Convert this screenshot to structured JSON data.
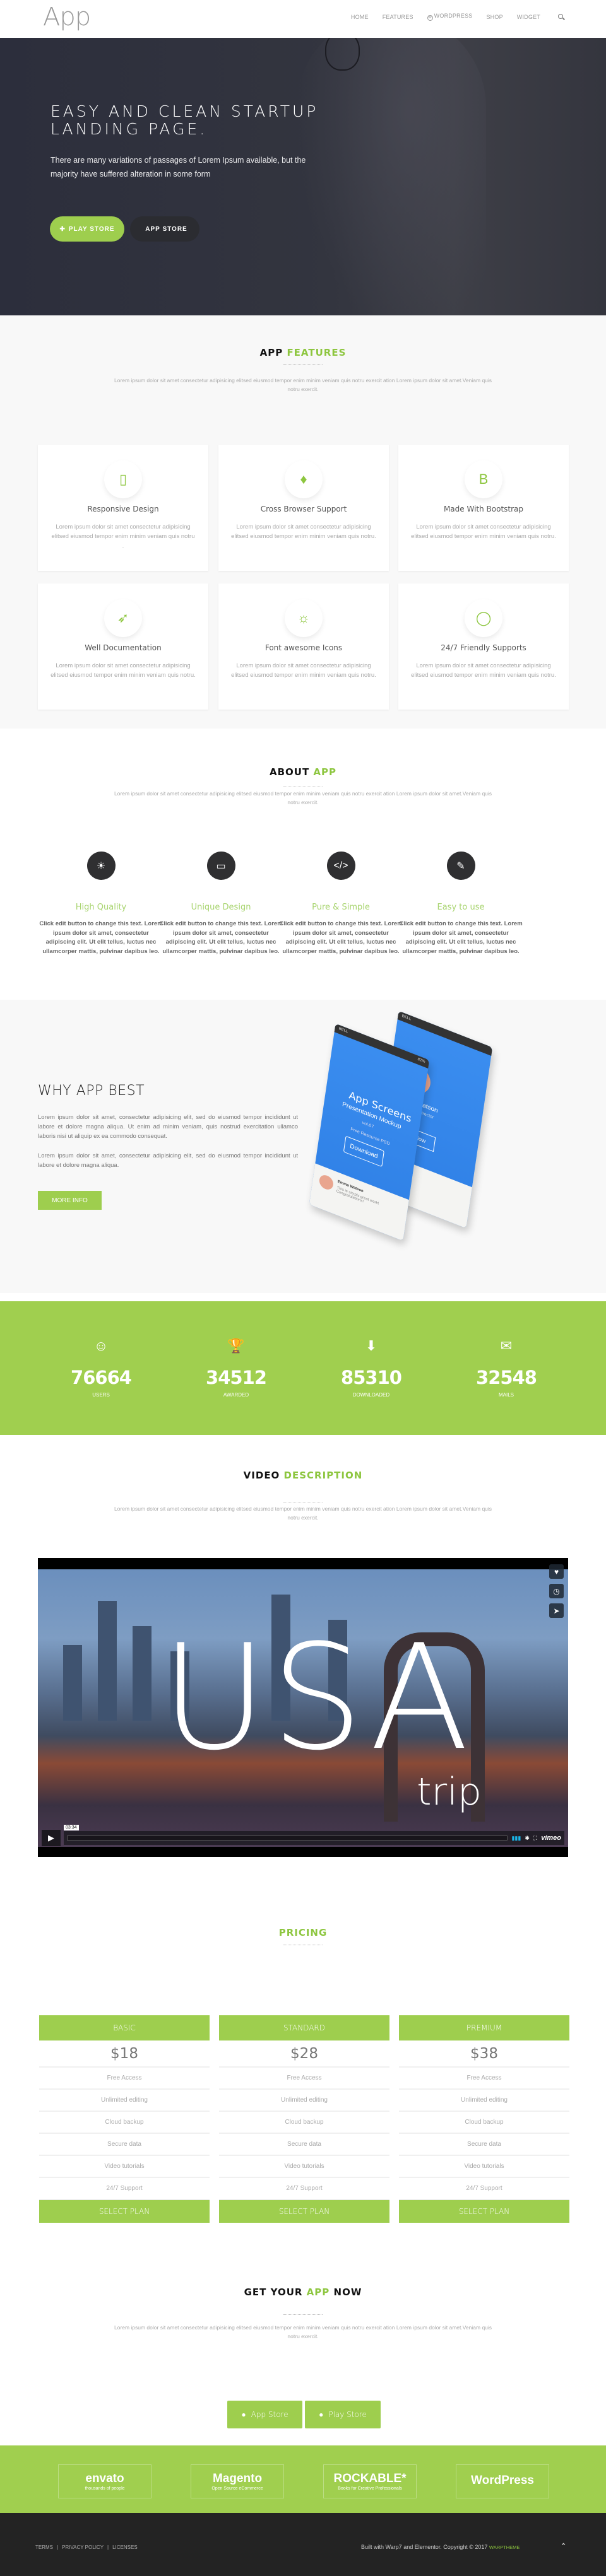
{
  "header": {
    "logo": "App",
    "nav": [
      "HOME",
      "FEATURES",
      "WORDPRESS",
      "SHOP",
      "WIDGET"
    ],
    "search_icon": "search-icon"
  },
  "hero": {
    "title": "EASY AND CLEAN STARTUP LANDING PAGE.",
    "subtitle": "There are many variations of passages of Lorem Ipsum available, but the majority have suffered alteration in some form",
    "play_store_label": "PLAY STORE",
    "app_store_label": "APP STORE",
    "slides": 2,
    "active_slide": 2
  },
  "features": {
    "title_a": "APP",
    "title_b": "FEATURES",
    "subtitle": "Lorem ipsum dolor sit amet consectetur adipisicing elitsed eiusmod tempor enim minim veniam quis notru exercit ation Lorem ipsum dolor sit amet.Veniam quis notru exercit.",
    "items": [
      {
        "icon": "mobile-icon",
        "glyph": "▯",
        "title": "Responsive Design",
        "text": "Lorem ipsum dolor sit amet consectetur adipisicing elitsed eiusmod tempor enim minim veniam quis notru ."
      },
      {
        "icon": "diamond-icon",
        "glyph": "♦",
        "title": "Cross Browser Support",
        "text": "Lorem ipsum dolor sit amet consectetur adipisicing elitsed eiusmod tempor enim minim veniam quis notru."
      },
      {
        "icon": "bootstrap-icon",
        "glyph": "B",
        "title": "Made With Bootstrap",
        "text": "Lorem ipsum dolor sit amet consectetur adipisicing elitsed eiusmod tempor enim minim veniam quis notru."
      },
      {
        "icon": "rocket-icon",
        "glyph": "➶",
        "title": "Well Documentation",
        "text": "Lorem ipsum dolor sit amet consectetur adipisicing elitsed eiusmod tempor enim minim veniam quis notru."
      },
      {
        "icon": "lightbulb-icon",
        "glyph": "☼",
        "title": "Font awesome Icons",
        "text": "Lorem ipsum dolor sit amet consectetur adipisicing elitsed eiusmod tempor enim minim veniam quis notru."
      },
      {
        "icon": "chat-bubble-icon",
        "glyph": "◯",
        "title": "24/7 Friendly Supports",
        "text": "Lorem ipsum dolor sit amet consectetur adipisicing elitsed eiusmod tempor enim minim veniam quis notru."
      }
    ]
  },
  "about": {
    "title_a": "ABOUT",
    "title_b": "APP",
    "subtitle": "Lorem ipsum dolor sit amet consectetur adipisicing elitsed eiusmod tempor enim minim veniam quis notru exercit ation Lorem ipsum dolor sit amet.Veniam quis notru exercit.",
    "items": [
      {
        "icon": "lightbulb-icon",
        "glyph": "☀",
        "title": "High Quality",
        "text": "Click edit button to change this text. Lorem ipsum dolor sit amet, consectetur adipiscing elit. Ut elit tellus, luctus nec ullamcorper mattis, pulvinar dapibus leo."
      },
      {
        "icon": "desktop-icon",
        "glyph": "▭",
        "title": "Unique Design",
        "text": "Click edit button to change this text. Lorem ipsum dolor sit amet, consectetur adipiscing elit. Ut elit tellus, luctus nec ullamcorper mattis, pulvinar dapibus leo."
      },
      {
        "icon": "code-icon",
        "glyph": "</>",
        "title": "Pure & Simple",
        "text": "Click edit button to change this text. Lorem ipsum dolor sit amet, consectetur adipiscing elit. Ut elit tellus, luctus nec ullamcorper mattis, pulvinar dapibus leo."
      },
      {
        "icon": "pencil-icon",
        "glyph": "✎",
        "title": "Easy to use",
        "text": "Click edit button to change this text. Lorem ipsum dolor sit amet, consectetur adipiscing elit. Ut elit tellus, luctus nec ullamcorper mattis, pulvinar dapibus leo."
      }
    ]
  },
  "why": {
    "title": "WHY APP BEST",
    "para1": "Lorem ipsum dolor sit amet, consectetur adipisicing elit, sed do eiusmod tempor incididunt ut labore et dolore magna aliqua. Ut enim ad minim veniam, quis nostrud exercitation ullamco laboris nisi ut aliquip ex ea commodo consequat.",
    "para2": "Lorem ipsum dolor sit amet, consectetur adipisicing elit, sed do eiusmod tempor incididunt ut labore et dolore magna aliqua.",
    "button": "MORE INFO",
    "mockup": {
      "carrier": "BELL",
      "battery": "82%",
      "app_title": "App Screens",
      "app_subtitle": "Presentation Mockup",
      "version": "vol.07",
      "resource": "Free Resource PSD",
      "download": "Download",
      "profile_name": "Emma Watson",
      "profile_role": "Design, Art Director",
      "follow": "+Follow",
      "message": "This is simply great work! Congratulations!"
    }
  },
  "stats": [
    {
      "icon": "smile-icon",
      "glyph": "☺",
      "value": "76664",
      "label": "USERS"
    },
    {
      "icon": "trophy-icon",
      "glyph": "🏆",
      "value": "34512",
      "label": "AWARDED"
    },
    {
      "icon": "download-icon",
      "glyph": "⬇",
      "value": "85310",
      "label": "DOWNLOADED"
    },
    {
      "icon": "envelope-icon",
      "glyph": "✉",
      "value": "32548",
      "label": "MAILS"
    }
  ],
  "video": {
    "title_a": "VIDEO",
    "title_b": "DESCRIPTION",
    "subtitle": "Lorem ipsum dolor sit amet consectetur adipisicing elitsed eiusmod tempor enim minim veniam quis notru exercit ation Lorem ipsum dolor sit amet.Veniam quis notru exercit.",
    "overlay_big": "USA",
    "overlay_small": "trip",
    "time": "03:34",
    "brand": "vimeo",
    "side_buttons": [
      "heart-icon",
      "clock-icon",
      "send-icon"
    ]
  },
  "pricing": {
    "title": "PRICING",
    "plans": [
      {
        "name": "BASIC",
        "price": "$18",
        "features": [
          "Free Access",
          "Unlimited editing",
          "Cloud backup",
          "Secure data",
          "Video tutorials",
          "24/7 Support"
        ],
        "button": "SELECT PLAN"
      },
      {
        "name": "STANDARD",
        "price": "$28",
        "features": [
          "Free Access",
          "Unlimited editing",
          "Cloud backup",
          "Secure data",
          "Video tutorials",
          "24/7 Support"
        ],
        "button": "SELECT PLAN"
      },
      {
        "name": "PREMIUM",
        "price": "$38",
        "features": [
          "Free Access",
          "Unlimited editing",
          "Cloud backup",
          "Secure data",
          "Video tutorials",
          "24/7 Support"
        ],
        "button": "SELECT PLAN"
      }
    ]
  },
  "cta": {
    "title_a": "GET YOUR",
    "title_b": "APP",
    "title_c": "NOW",
    "subtitle": "Lorem ipsum dolor sit amet consectetur adipisicing elitsed eiusmod tempor enim minim veniam quis notru exercit ation Lorem ipsum dolor sit amet.Veniam quis notru exercit.",
    "app_store": "App Store",
    "play_store": "Play Store"
  },
  "partners": [
    {
      "name": "envato",
      "sub": "thousands of people"
    },
    {
      "name": "Magento",
      "sub": "Open Source eCommerce"
    },
    {
      "name": "ROCKABLE*",
      "sub": "Books for Creative Professionals"
    },
    {
      "name": "WordPress",
      "sub": ""
    }
  ],
  "footer": {
    "links": [
      "TERMS",
      "PRIVACY POLICY",
      "LICENSES"
    ],
    "copyright": "Built with Warp7 and Elementor. Copyright © 2017",
    "brand": "WARPTHEME"
  },
  "colors": {
    "accent": "#9ece4e",
    "dark": "#232323",
    "hero": "#30323d"
  }
}
